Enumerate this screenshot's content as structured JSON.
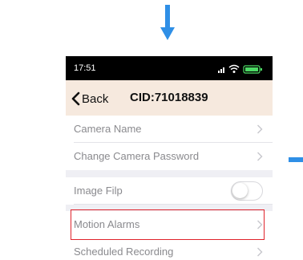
{
  "status_bar": {
    "time": "17:51"
  },
  "nav": {
    "back_label": "Back",
    "title": "CID:71018839"
  },
  "settings": {
    "camera_name": "Camera Name",
    "change_password": "Change Camera Password",
    "image_flip": "Image Filp",
    "image_flip_enabled": false,
    "motion_alarms": "Motion Alarms",
    "scheduled_recording": "Scheduled Recording"
  },
  "colors": {
    "arrow_blue": "#2f8fe6",
    "highlight_red": "#e0242c",
    "nav_background": "#f6e9de",
    "battery_green": "#4cd964"
  },
  "icons": [
    "arrow-down-icon",
    "signal-icon",
    "wifi-icon",
    "battery-icon",
    "back-chevron-icon",
    "chevron-right-icon"
  ]
}
